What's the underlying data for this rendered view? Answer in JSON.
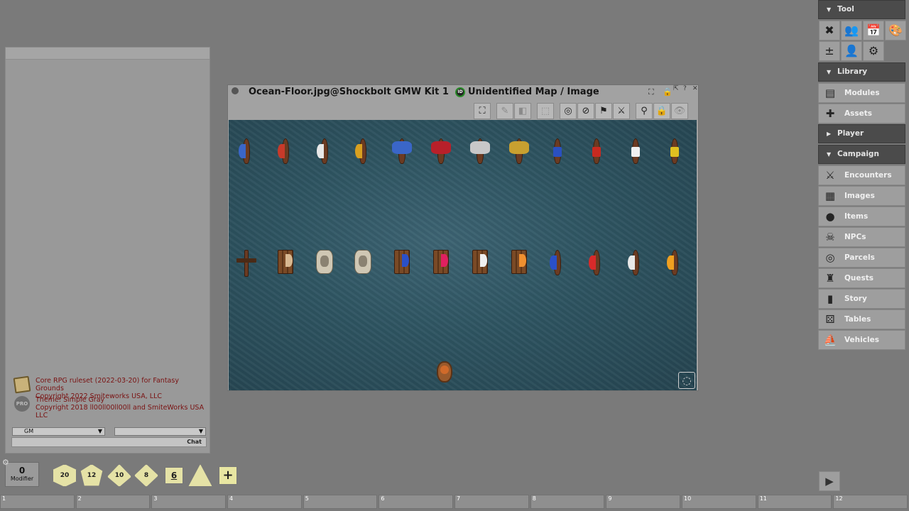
{
  "chat": {
    "messages": [
      {
        "line1": "Core RPG ruleset (2022-03-20) for Fantasy Grounds",
        "line2": "Copyright 2022 Smiteworks USA, LLC"
      },
      {
        "line1": "Theme: Simple Gray",
        "line2": "Copyright 2018 ll00ll00ll00ll and SmiteWorks USA LLC"
      }
    ],
    "pro_badge": "PRO",
    "identity": "GM",
    "chat_label": "Chat"
  },
  "image_window": {
    "title": "Ocean-Floor.jpg@Shockbolt GMW Kit 1",
    "id_badge": "ID",
    "subtitle": "Unidentified Map / Image",
    "tokens_row1": [
      {
        "kind": "ship",
        "color": "#3a66c8"
      },
      {
        "kind": "ship",
        "color": "#c83a2a"
      },
      {
        "kind": "ship",
        "color": "#e8e8e8"
      },
      {
        "kind": "ship",
        "color": "#d8a020"
      },
      {
        "kind": "wide",
        "color": "#3a66c8"
      },
      {
        "kind": "wide",
        "color": "#b8202a"
      },
      {
        "kind": "wide",
        "color": "#c8c8c8"
      },
      {
        "kind": "wide",
        "color": "#c8a030"
      },
      {
        "kind": "rig",
        "color": "#2a50c0"
      },
      {
        "kind": "rig",
        "color": "#c82a20"
      },
      {
        "kind": "rig",
        "color": "#f0f0f0"
      },
      {
        "kind": "rig",
        "color": "#e0c020"
      }
    ],
    "tokens_row2": [
      {
        "kind": "cross",
        "color": "#4a2a16"
      },
      {
        "kind": "raft",
        "color": "#d8b890"
      },
      {
        "kind": "crest",
        "color": "#8a8272"
      },
      {
        "kind": "crest",
        "color": "#8a8272"
      },
      {
        "kind": "raft",
        "color": "#2a50c8"
      },
      {
        "kind": "raft",
        "color": "#e02060"
      },
      {
        "kind": "raft",
        "color": "#f0f0f0"
      },
      {
        "kind": "raft",
        "color": "#f09030"
      },
      {
        "kind": "ship",
        "color": "#2a50c8"
      },
      {
        "kind": "ship",
        "color": "#d82a2a"
      },
      {
        "kind": "ship",
        "color": "#e8e8e8"
      },
      {
        "kind": "ship",
        "color": "#f0a020"
      }
    ],
    "toolbar": [
      "expand-icon",
      "draw-icon",
      "eraser-icon",
      "select-icon",
      "target-icon",
      "hide-icon",
      "flag-icon",
      "swords-icon",
      "pin-icon",
      "lock-icon",
      "visibility-icon"
    ]
  },
  "sidebar": {
    "tool_header": "Tool",
    "library_header": "Library",
    "player_header": "Player",
    "campaign_header": "Campaign",
    "library_items": [
      {
        "label": "Modules",
        "icon": "books-icon"
      },
      {
        "label": "Assets",
        "icon": "puzzle-icon"
      }
    ],
    "campaign_items": [
      {
        "label": "Encounters",
        "icon": "swords-icon"
      },
      {
        "label": "Images",
        "icon": "map-icon"
      },
      {
        "label": "Items",
        "icon": "bag-icon"
      },
      {
        "label": "NPCs",
        "icon": "skull-icon"
      },
      {
        "label": "Parcels",
        "icon": "coins-icon"
      },
      {
        "label": "Quests",
        "icon": "trophy-icon"
      },
      {
        "label": "Story",
        "icon": "book-icon"
      },
      {
        "label": "Tables",
        "icon": "dice-icon"
      },
      {
        "label": "Vehicles",
        "icon": "sailboat-icon"
      }
    ]
  },
  "dice": {
    "modifier_value": "0",
    "modifier_label": "Modifier",
    "d20": "20",
    "d12": "12",
    "d10": "10",
    "d8": "8",
    "d6": "6",
    "add": "+"
  },
  "hotkeys": [
    "1",
    "2",
    "3",
    "4",
    "5",
    "6",
    "7",
    "8",
    "9",
    "10",
    "11",
    "12"
  ]
}
